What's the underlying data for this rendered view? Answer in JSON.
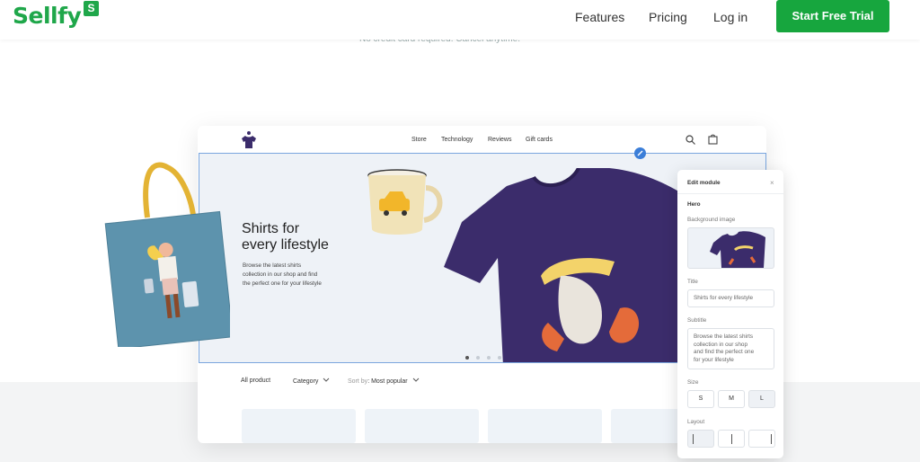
{
  "header": {
    "logo": "Sellfy",
    "logo_badge": "S",
    "nav": [
      "Features",
      "Pricing",
      "Log in"
    ],
    "cta": "Start Free Trial",
    "subnote": "No credit card required. Cancel anytime."
  },
  "store": {
    "nav": [
      "Store",
      "Technology",
      "Reviews",
      "Gift cards"
    ],
    "hero": {
      "title_line1": "Shirts for",
      "title_line2": "every lifestyle",
      "sub_line1": "Browse the latest shirts",
      "sub_line2": "collection in our shop and find",
      "sub_line3": "the perfect one for your lifestyle",
      "active_slide": 1,
      "slide_count": 4
    },
    "filters": {
      "all": "All product",
      "category": "Category",
      "sort_label": "Sort by",
      "sort_value": "Most popular"
    }
  },
  "edit_module": {
    "title": "Edit module",
    "close": "×",
    "section": "Hero",
    "background_label": "Background image",
    "title_label": "Title",
    "title_value": "Shirts for every lifestyle",
    "subtitle_label": "Subtitle",
    "subtitle_value_1": "Browse the latest shirts",
    "subtitle_value_2": "collection in our shop",
    "subtitle_value_3": "and find the perfect one",
    "subtitle_value_4": "for your lifestyle",
    "size_label": "Size",
    "sizes": [
      "S",
      "M",
      "L"
    ],
    "selected_size": "L",
    "layout_label": "Layout"
  },
  "colors": {
    "brand_green": "#1fa74a",
    "cta_green": "#17a63e",
    "shirt_navy": "#3b2c6b",
    "tote_blue": "#5d93ad",
    "highlight_blue": "#3b7ed8"
  }
}
